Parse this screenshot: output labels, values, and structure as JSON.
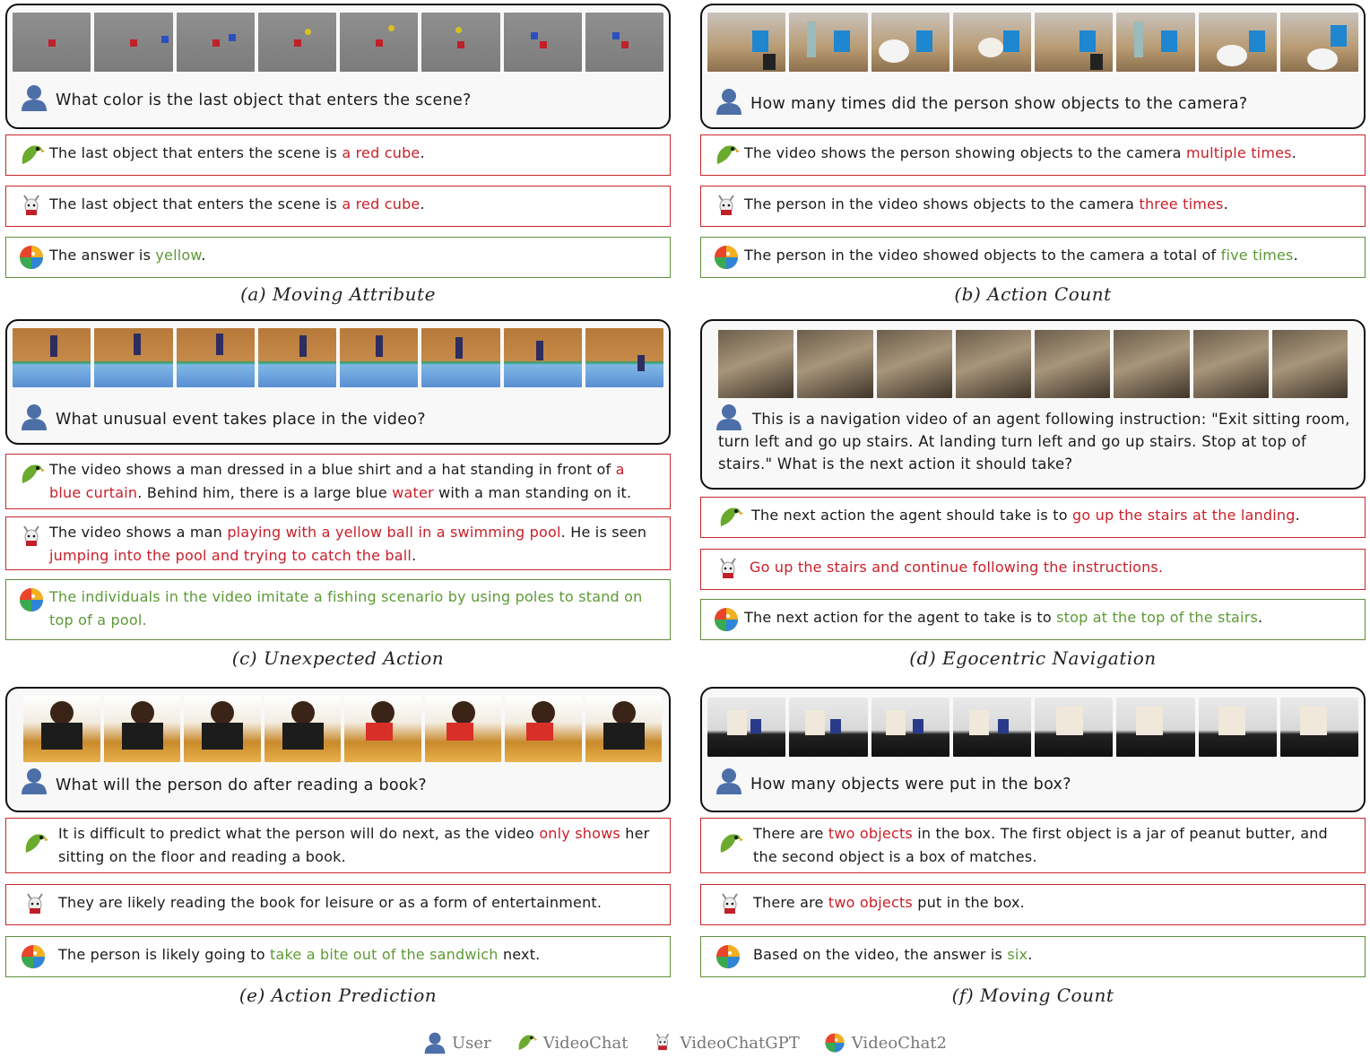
{
  "panels": [
    {
      "id": "a",
      "question": "What color is the last object that enters the scene?",
      "answers": [
        {
          "model": "VideoChat",
          "correct": false,
          "parts": [
            "The last object that enters the scene is ",
            "a red cube",
            "."
          ]
        },
        {
          "model": "VideoChatGPT",
          "correct": false,
          "parts": [
            "The last object that enters the scene is ",
            "a red cube",
            "."
          ]
        },
        {
          "model": "VideoChat2",
          "correct": true,
          "parts": [
            "The answer is ",
            "yellow",
            "."
          ]
        }
      ],
      "caption": "(a) Moving Attribute"
    },
    {
      "id": "b",
      "question": "How many times did the person show objects to the camera?",
      "answers": [
        {
          "model": "VideoChat",
          "correct": false,
          "parts": [
            "The video shows the person showing objects to the camera ",
            "multiple times",
            "."
          ]
        },
        {
          "model": "VideoChatGPT",
          "correct": false,
          "parts": [
            "The person in the video shows objects to the camera ",
            "three times",
            "."
          ]
        },
        {
          "model": "VideoChat2",
          "correct": true,
          "parts": [
            "The person in the video showed objects to the camera a total of ",
            "five times",
            "."
          ]
        }
      ],
      "caption": "(b) Action Count"
    },
    {
      "id": "c",
      "question": "What unusual event takes place in the video?",
      "answers": [
        {
          "model": "VideoChat",
          "correct": false,
          "parts": [
            "The video shows a man dressed in a blue shirt and a hat standing in front of ",
            "a blue curtain",
            ". Behind him, there is a large blue ",
            "water",
            " with a man standing on it."
          ]
        },
        {
          "model": "VideoChatGPT",
          "correct": false,
          "parts": [
            "The video shows a man ",
            "playing with a yellow ball in a swimming pool",
            ". He is seen ",
            "jumping into the pool and trying to catch the ball",
            "."
          ]
        },
        {
          "model": "VideoChat2",
          "correct": true,
          "parts": [
            "",
            "The individuals in the video imitate a fishing scenario by using poles to stand on top of a pool",
            "."
          ]
        }
      ],
      "caption": "(c) Unexpected Action"
    },
    {
      "id": "d",
      "question": "This is a navigation video of an agent following instruction: \"Exit sitting room, turn left and go up stairs. At landing turn left and go up stairs. Stop at top of stairs.\" What is the next action it should take?",
      "answers": [
        {
          "model": "VideoChat",
          "correct": false,
          "parts": [
            "The next action the agent should take is to ",
            "go up the stairs at the landing",
            "."
          ]
        },
        {
          "model": "VideoChatGPT",
          "correct": false,
          "parts": [
            "",
            "Go up the stairs and continue following the instructions.",
            ""
          ]
        },
        {
          "model": "VideoChat2",
          "correct": true,
          "parts": [
            "The next action for the agent to take is to ",
            "stop at the top of the stairs",
            "."
          ]
        }
      ],
      "caption": "(d) Egocentric Navigation"
    },
    {
      "id": "e",
      "question": "What will the person do after reading a book?",
      "answers": [
        {
          "model": "VideoChat",
          "correct": false,
          "parts": [
            "It is difficult to predict what the person will do next, as the video ",
            "only shows",
            " her sitting on the floor and reading a book."
          ]
        },
        {
          "model": "VideoChatGPT",
          "correct": false,
          "parts": [
            "They are likely reading the book for leisure or as a form of entertainment.",
            "",
            ""
          ]
        },
        {
          "model": "VideoChat2",
          "correct": true,
          "parts": [
            "The person is likely going to ",
            "take a bite out of the sandwich",
            " next."
          ]
        }
      ],
      "caption": "(e) Action Prediction"
    },
    {
      "id": "f",
      "question": "How many objects were put in the box?",
      "answers": [
        {
          "model": "VideoChat",
          "correct": false,
          "parts": [
            "There are ",
            "two objects",
            " in the box. The first object is a jar of peanut butter, and the second object is a box of matches."
          ]
        },
        {
          "model": "VideoChatGPT",
          "correct": false,
          "parts": [
            "There are ",
            "two objects",
            " put in the box."
          ]
        },
        {
          "model": "VideoChat2",
          "correct": true,
          "parts": [
            "Based on the video, the answer is ",
            "six",
            "."
          ]
        }
      ],
      "caption": "(f) Moving Count"
    }
  ],
  "legend": {
    "user": "User",
    "videochat": "VideoChat",
    "videochatgpt": "VideoChatGPT",
    "videochat2": "VideoChat2"
  },
  "colors": {
    "wrong": "#c8262c",
    "right": "#5f8f3c"
  }
}
